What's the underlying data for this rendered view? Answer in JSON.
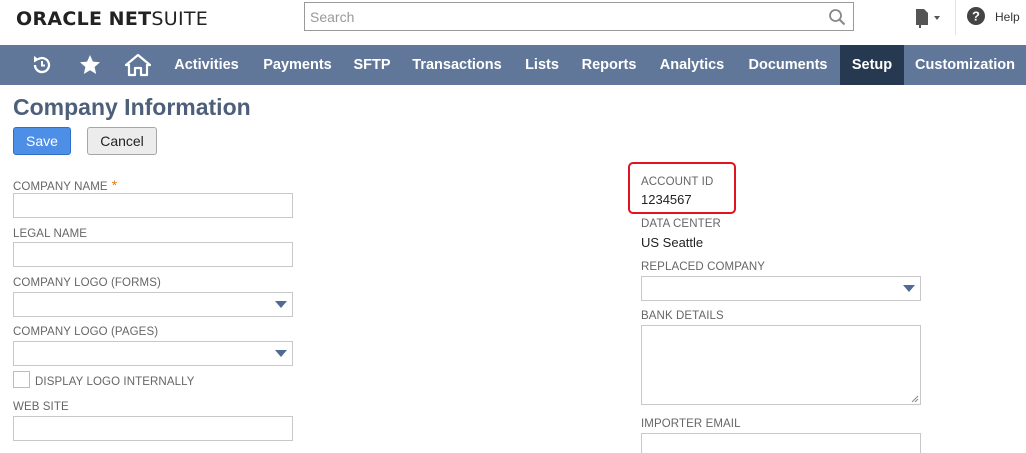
{
  "header": {
    "logo_oracle": "ORACLE",
    "logo_net": "NET",
    "logo_suite": "SUITE",
    "search_placeholder": "Search",
    "help_label": "Help"
  },
  "nav": {
    "icons": [
      "recent-records-icon",
      "favorites-star-icon",
      "home-icon"
    ],
    "items": [
      {
        "label": "Activities"
      },
      {
        "label": "Payments"
      },
      {
        "label": "SFTP"
      },
      {
        "label": "Transactions"
      },
      {
        "label": "Lists"
      },
      {
        "label": "Reports"
      },
      {
        "label": "Analytics"
      },
      {
        "label": "Documents"
      },
      {
        "label": "Setup",
        "active": true
      },
      {
        "label": "Customization"
      }
    ]
  },
  "page": {
    "title": "Company Information",
    "save_label": "Save",
    "cancel_label": "Cancel"
  },
  "left_form": {
    "company_name_label": "COMPANY NAME",
    "required_marker": "*",
    "company_name_value": "",
    "legal_name_label": "LEGAL NAME",
    "legal_name_value": "",
    "logo_forms_label": "COMPANY LOGO (FORMS)",
    "logo_forms_value": "",
    "logo_pages_label": "COMPANY LOGO (PAGES)",
    "logo_pages_value": "",
    "display_logo_label": "DISPLAY LOGO INTERNALLY",
    "display_logo_checked": false,
    "web_site_label": "WEB SITE",
    "web_site_value": ""
  },
  "right_form": {
    "account_id_label": "ACCOUNT ID",
    "account_id_value": "1234567",
    "data_center_label": "DATA CENTER",
    "data_center_value": "US Seattle",
    "replaced_company_label": "REPLACED COMPANY",
    "replaced_company_value": "",
    "bank_details_label": "BANK DETAILS",
    "bank_details_value": "",
    "importer_email_label": "IMPORTER EMAIL",
    "importer_email_value": ""
  },
  "colors": {
    "navbar": "#607799",
    "navbar_active": "#263951",
    "title": "#4d5f79",
    "save_button": "#4d8fe6",
    "highlight": "#e0141e",
    "required": "#e07b1a"
  }
}
